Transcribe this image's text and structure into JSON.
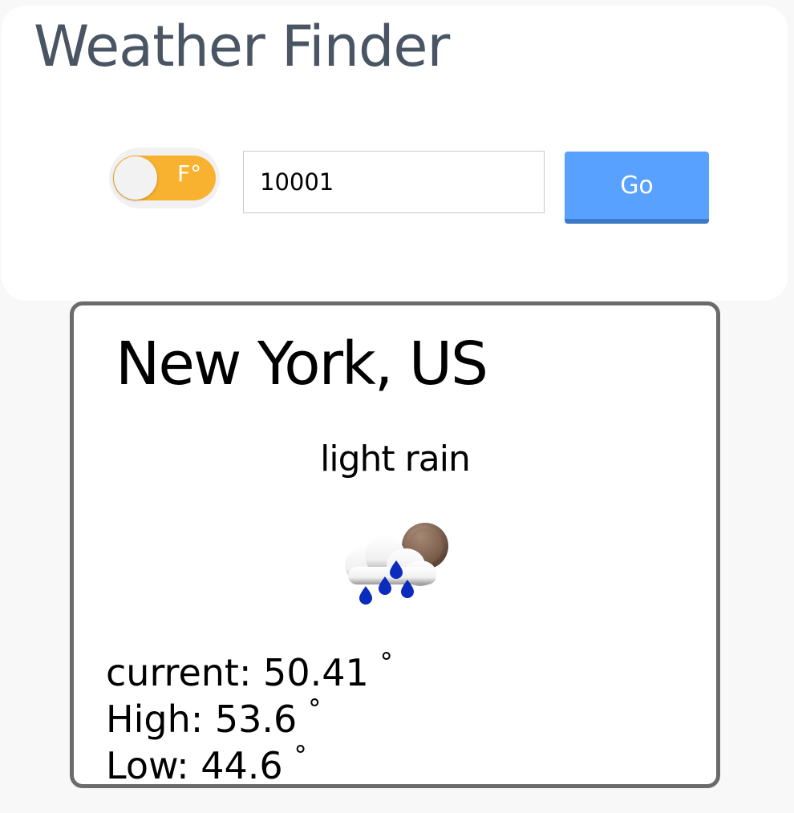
{
  "app": {
    "title": "Weather Finder"
  },
  "search": {
    "unit_label": "F°",
    "unit_toggle_on": true,
    "zip_value": "10001",
    "go_label": "Go"
  },
  "weather": {
    "city": "New York, US",
    "description": "light rain",
    "icon": "light-rain-icon",
    "current_label": "current: 50.41",
    "high_label": "High: 53.6",
    "low_label": "Low: 44.6",
    "degree_symbol": "°"
  },
  "colors": {
    "title_text": "#4a5563",
    "toggle_on": "#f9b22f",
    "go_button": "#59a1ff",
    "card_border": "#6b6b6b"
  }
}
